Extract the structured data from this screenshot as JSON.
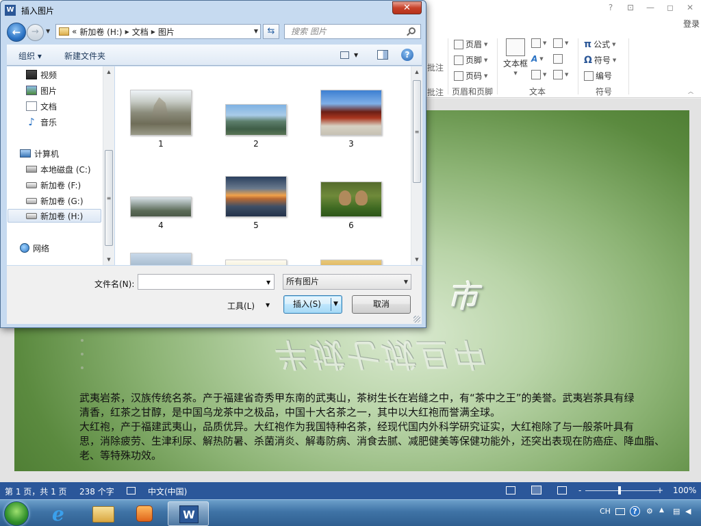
{
  "word": {
    "signin": "登录",
    "title_buttons": [
      "?",
      "⊡",
      "—",
      "◻",
      "✕"
    ],
    "ribbon": {
      "partial_left": "批注",
      "header_footer": {
        "items": [
          "页眉",
          "页脚",
          "页码"
        ],
        "label": "页眉和页脚"
      },
      "text": {
        "textbox": "文本框",
        "label": "文本"
      },
      "symbols": {
        "items": [
          "公式",
          "符号",
          "编号"
        ],
        "label": "符号"
      }
    },
    "document": {
      "wordart_1": "市",
      "wordart_2": "半城七城旦中",
      "paragraphs": [
        "    武夷岩茶，汉族传统名茶。产于福建省奇秀甲东南的武夷山，茶树生长在岩缝之中，有“茶中之王”的美誉。武夷岩茶具有绿",
        "清香，红茶之甘醇，是中国乌龙茶中之极品，中国十大名茶之一，其中以大红袍而誉满全球。",
        "    大红袍，产于福建武夷山，品质优异。大红袍作为我国特种名茶，经现代国内外科学研究证实，大红袍除了与一般茶叶具有",
        "思，消除疲劳、生津利尿、解热防暑、杀菌消炎、解毒防病、消食去腻、减肥健美等保健功能外，还突出表现在防癌症、降血脂、",
        "老、等特殊功效。"
      ]
    },
    "status": {
      "page": "第 1 页，共 1 页",
      "words": "238 个字",
      "language": "中文(中国)",
      "zoom": "100%",
      "zoom_minus": "-",
      "zoom_plus": "+"
    }
  },
  "dialog": {
    "title": "插入图片",
    "close": "✕",
    "breadcrumbs": [
      "«",
      "新加卷 (H:)",
      "文档",
      "图片"
    ],
    "search_placeholder": "搜索 图片",
    "toolbar": {
      "organize": "组织 ▾",
      "new_folder": "新建文件夹",
      "help": "?"
    },
    "nav": {
      "items": [
        "视频",
        "图片",
        "文档",
        "音乐"
      ],
      "computer": "计算机",
      "drives": [
        "本地磁盘 (C:)",
        "新加卷 (F:)",
        "新加卷 (G:)",
        "新加卷 (H:)"
      ],
      "network": "网络"
    },
    "files": [
      "1",
      "2",
      "3",
      "4",
      "5",
      "6"
    ],
    "filename_label": "文件名(N):",
    "filename_value": "",
    "filetype": "所有图片",
    "tools": "工具(L)",
    "insert": "插入(S)",
    "cancel": "取消"
  },
  "taskbar": {
    "apps": [
      "ie-icon",
      "explorer-icon",
      "media-player-icon",
      "word-icon"
    ],
    "tray": {
      "lang": "CH"
    }
  }
}
